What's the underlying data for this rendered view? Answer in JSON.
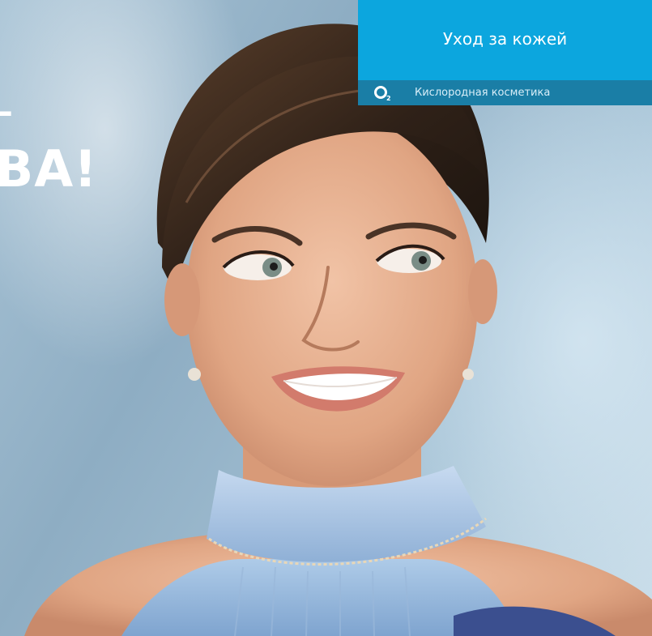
{
  "headline": {
    "dash": "–",
    "word": "ВА!"
  },
  "banner": {
    "title": "Уход за кожей",
    "subtitle": "Кислородная косметика",
    "icon": "o2-icon",
    "bg_color": "#0ca6de",
    "strip_color": "#1a7ea6"
  }
}
